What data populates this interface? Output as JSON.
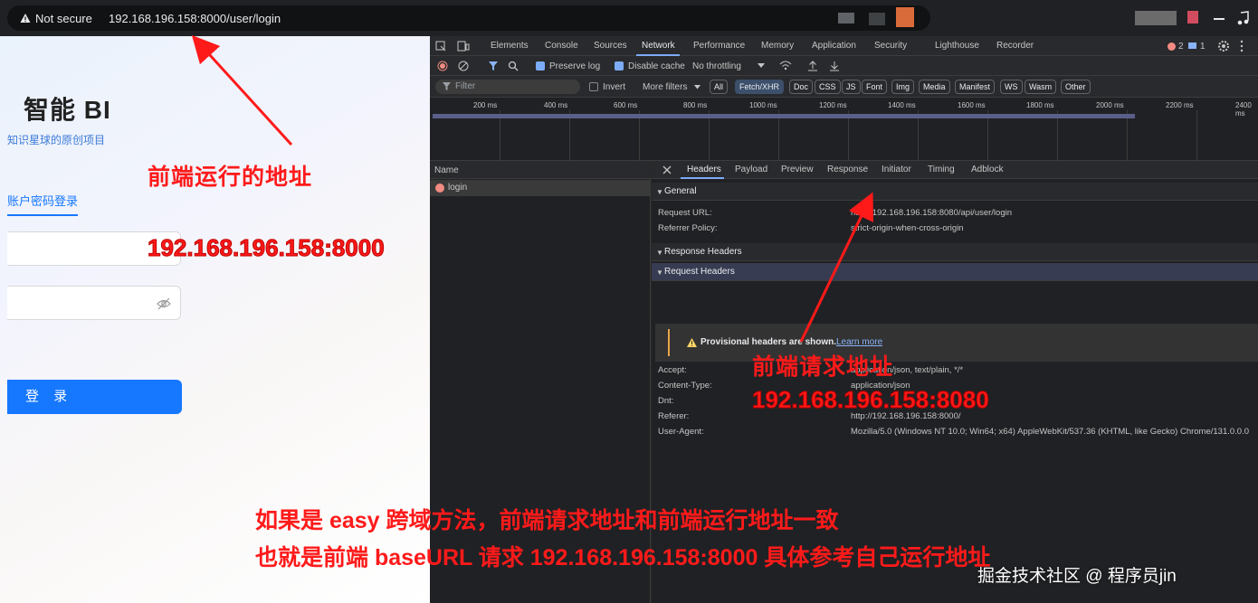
{
  "address_bar": {
    "security_label": "Not secure",
    "url": "192.168.196.158:8000/user/login"
  },
  "login_page": {
    "brand": "智能 BI",
    "subtitle": "知识星球的原创项目",
    "tab_label": "账户密码登录",
    "login_button": "登 录"
  },
  "devtools": {
    "panel_tabs": [
      "Elements",
      "Console",
      "Sources",
      "Network",
      "Performance",
      "Memory",
      "Application",
      "Security",
      "Lighthouse",
      "Recorder"
    ],
    "active_tab": "Network",
    "error_count": "2",
    "message_count": "1",
    "toolbar": {
      "preserve_log": "Preserve log",
      "disable_cache": "Disable cache",
      "throttling": "No throttling"
    },
    "filter_bar": {
      "filter_placeholder": "Filter",
      "invert": "Invert",
      "more_filters": "More filters",
      "types": [
        "All",
        "Fetch/XHR",
        "Doc",
        "CSS",
        "JS",
        "Font",
        "Img",
        "Media",
        "Manifest",
        "WS",
        "Wasm",
        "Other"
      ]
    },
    "timeline_ticks": [
      "200 ms",
      "400 ms",
      "600 ms",
      "800 ms",
      "1000 ms",
      "1200 ms",
      "1400 ms",
      "1600 ms",
      "1800 ms",
      "2000 ms",
      "2200 ms",
      "2400 ms"
    ],
    "requests_header": "Name",
    "requests": [
      "login"
    ],
    "detail_tabs": [
      "Headers",
      "Payload",
      "Preview",
      "Response",
      "Initiator",
      "Timing",
      "Adblock"
    ],
    "general": {
      "title": "General",
      "rows": [
        {
          "key": "Request URL:",
          "value": "http://192.168.196.158:8080/api/user/login"
        },
        {
          "key": "Referrer Policy:",
          "value": "strict-origin-when-cross-origin"
        }
      ]
    },
    "response_headers_title": "Response Headers",
    "request_headers": {
      "title": "Request Headers",
      "provisional_text": "Provisional headers are shown.",
      "learn_more": "Learn more",
      "rows": [
        {
          "key": "Accept:",
          "value": "application/json, text/plain, */*"
        },
        {
          "key": "Content-Type:",
          "value": "application/json"
        },
        {
          "key": "Dnt:",
          "value": ""
        },
        {
          "key": "Referer:",
          "value": "http://192.168.196.158:8000/"
        },
        {
          "key": "User-Agent:",
          "value": "Mozilla/5.0 (Windows NT 10.0; Win64; x64) AppleWebKit/537.36 (KHTML, like Gecko) Chrome/131.0.0.0"
        }
      ]
    }
  },
  "annotations": {
    "frontend_run_label": "前端运行的地址",
    "frontend_run_ip": "192.168.196.158:8000",
    "frontend_request_label": "前端请求地址",
    "frontend_request_ip": "192.168.196.158:8080",
    "note_line1": "如果是 easy 跨域方法，前端请求地址和前端运行地址一致",
    "note_line2": "也就是前端 baseURL 请求 192.168.196.158:8000 具体参考自己运行地址"
  },
  "watermark": "掘金技术社区 @ 程序员jin",
  "colors": {
    "annotation_red": "#ff1a1a",
    "primary_blue": "#1677ff",
    "devtools_bg": "#202124"
  }
}
